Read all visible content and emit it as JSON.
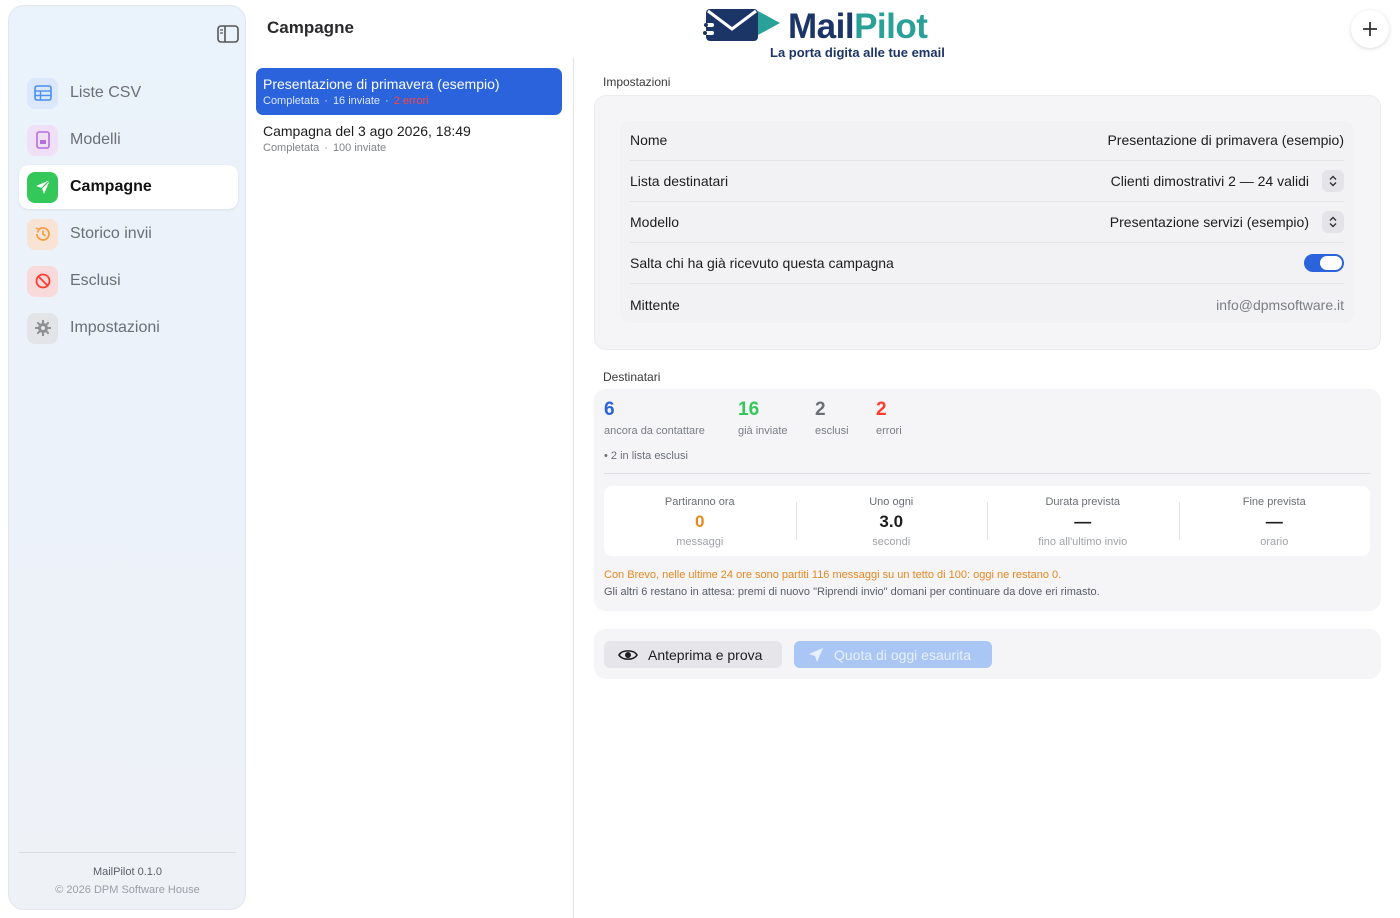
{
  "app": {
    "logo_name_part1": "Mail",
    "logo_name_part2": "Pilot",
    "logo_tagline": "La porta digita alle tue email",
    "version": "MailPilot 0.1.0",
    "copyright": "© 2026 DPM Software House"
  },
  "sidebar": {
    "items": [
      {
        "label": "Liste CSV",
        "icon": "table-icon",
        "color": "#4a8ef0",
        "active": false
      },
      {
        "label": "Modelli",
        "icon": "document-icon",
        "color": "#b46fe0",
        "active": false
      },
      {
        "label": "Campagne",
        "icon": "paper-plane-icon",
        "color": "#34c759",
        "active": true
      },
      {
        "label": "Storico invii",
        "icon": "history-icon",
        "color": "#f39a3c",
        "active": false
      },
      {
        "label": "Esclusi",
        "icon": "prohibited-icon",
        "color": "#ff3b30",
        "active": false
      },
      {
        "label": "Impostazioni",
        "icon": "gear-icon",
        "color": "#8e8e93",
        "active": false
      }
    ]
  },
  "list": {
    "title": "Campagne",
    "campaigns": [
      {
        "title": "Presentazione di primavera (esempio)",
        "status": "Completata",
        "sent": "16 inviate",
        "errors": "2 errori",
        "selected": true
      },
      {
        "title": "Campagna del 3 ago 2026, 18:49",
        "status": "Completata",
        "sent": "100 inviate",
        "errors": "",
        "selected": false
      }
    ]
  },
  "settings": {
    "section_label": "Impostazioni",
    "rows": {
      "name": {
        "key": "Nome",
        "value": "Presentazione di primavera (esempio)"
      },
      "list": {
        "key": "Lista destinatari",
        "value": "Clienti dimostrativi 2 — 24 validi"
      },
      "template": {
        "key": "Modello",
        "value": "Presentazione servizi (esempio)"
      },
      "skip": {
        "key": "Salta chi ha già ricevuto questa campagna",
        "value": true
      },
      "sender": {
        "key": "Mittente",
        "value": "info@dpmsoftware.it"
      }
    }
  },
  "recipients": {
    "section_label": "Destinatari",
    "stats": [
      {
        "value": "6",
        "label": "ancora da contattare",
        "color": "#2a63dc"
      },
      {
        "value": "16",
        "label": "già inviate",
        "color": "#34c759"
      },
      {
        "value": "2",
        "label": "esclusi",
        "color": "#6b6f76"
      },
      {
        "value": "2",
        "label": "errori",
        "color": "#ff3b30"
      }
    ],
    "excluded_note": "• 2 in lista esclusi",
    "metrics": [
      {
        "title": "Partiranno ora",
        "value": "0",
        "unit": "messaggi",
        "color": "#e6871f"
      },
      {
        "title": "Uno ogni",
        "value": "3.0",
        "unit": "secondi",
        "color": "#1d1d1f"
      },
      {
        "title": "Durata prevista",
        "value": "—",
        "unit": "fino all'ultimo invio",
        "color": "#1d1d1f"
      },
      {
        "title": "Fine prevista",
        "value": "—",
        "unit": "orario",
        "color": "#1d1d1f"
      }
    ],
    "warning": "Con Brevo, nelle ultime 24 ore sono partiti 116 messaggi su un tetto di 100: oggi ne restano 0.",
    "info": "Gli altri 6 restano in attesa: premi di nuovo \"Riprendi invio\" domani per continuare da dove eri rimasto."
  },
  "actions": {
    "preview_label": "Anteprima e prova",
    "quota_label": "Quota di oggi esaurita"
  }
}
